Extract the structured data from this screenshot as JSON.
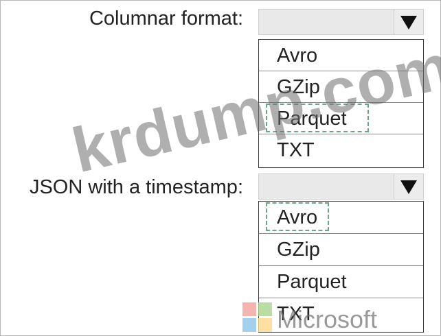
{
  "questions": [
    {
      "label": "Columnar format:",
      "selected_value": "",
      "options": [
        "Avro",
        "GZip",
        "Parquet",
        "TXT"
      ],
      "highlighted_option": "Parquet"
    },
    {
      "label": "JSON with a timestamp:",
      "selected_value": "",
      "options": [
        "Avro",
        "GZip",
        "Parquet",
        "TXT"
      ],
      "highlighted_option": "Avro"
    }
  ],
  "icons": {
    "dropdown": "triangle-down-icon"
  },
  "colors": {
    "highlight_dash": "#6aa685",
    "select_bg": "#e9e9e9"
  },
  "watermark": {
    "text": "krdump.com"
  },
  "logo": {
    "text": "Microsoft"
  }
}
